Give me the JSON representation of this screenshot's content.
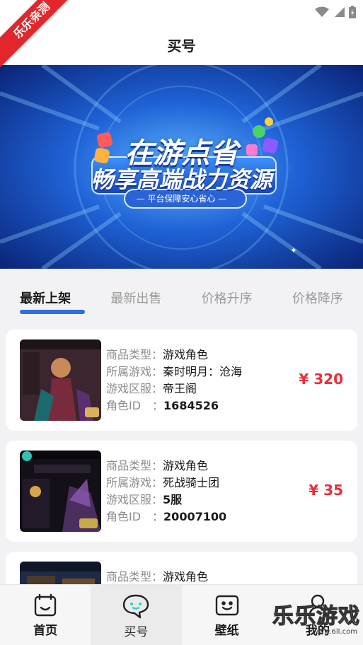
{
  "ribbon": "乐乐亲测",
  "header": {
    "title": "买号"
  },
  "banner": {
    "headline": "在游点省",
    "subheadline": "畅享高端战力资源",
    "tagline": "— 平台保障安心省心 —"
  },
  "tabs": [
    {
      "label": "最新上架",
      "active": true
    },
    {
      "label": "最新出售",
      "active": false
    },
    {
      "label": "价格升序",
      "active": false
    },
    {
      "label": "价格降序",
      "active": false
    }
  ],
  "listings": [
    {
      "type_label": "商品类型：",
      "type": "游戏角色",
      "game_label": "所属游戏：",
      "game": "秦时明月：沧海",
      "server_label": "游戏区服：",
      "server": "帝王阁",
      "id_label": "角色ID　：",
      "id": "1684526",
      "price": "¥ 320"
    },
    {
      "type_label": "商品类型：",
      "type": "游戏角色",
      "game_label": "所属游戏：",
      "game": "死战骑士团",
      "server_label": "游戏区服：",
      "server": "5服",
      "id_label": "角色ID　：",
      "id": "20007100",
      "price": "¥ 35"
    },
    {
      "type_label": "商品类型：",
      "type": "游戏角色"
    }
  ],
  "nav": [
    {
      "label": "首页",
      "icon": "home-box-icon"
    },
    {
      "label": "买号",
      "icon": "chat-bubble-icon",
      "active": true
    },
    {
      "label": "壁纸",
      "icon": "wallpaper-icon"
    },
    {
      "label": "我的",
      "icon": "profile-icon"
    }
  ],
  "watermark": {
    "text": "乐乐游戏",
    "url": "www.6ll.com"
  },
  "colors": {
    "accent": "#2d6fe0",
    "price": "#ea2e3a",
    "ribbon": "#e2262b"
  }
}
